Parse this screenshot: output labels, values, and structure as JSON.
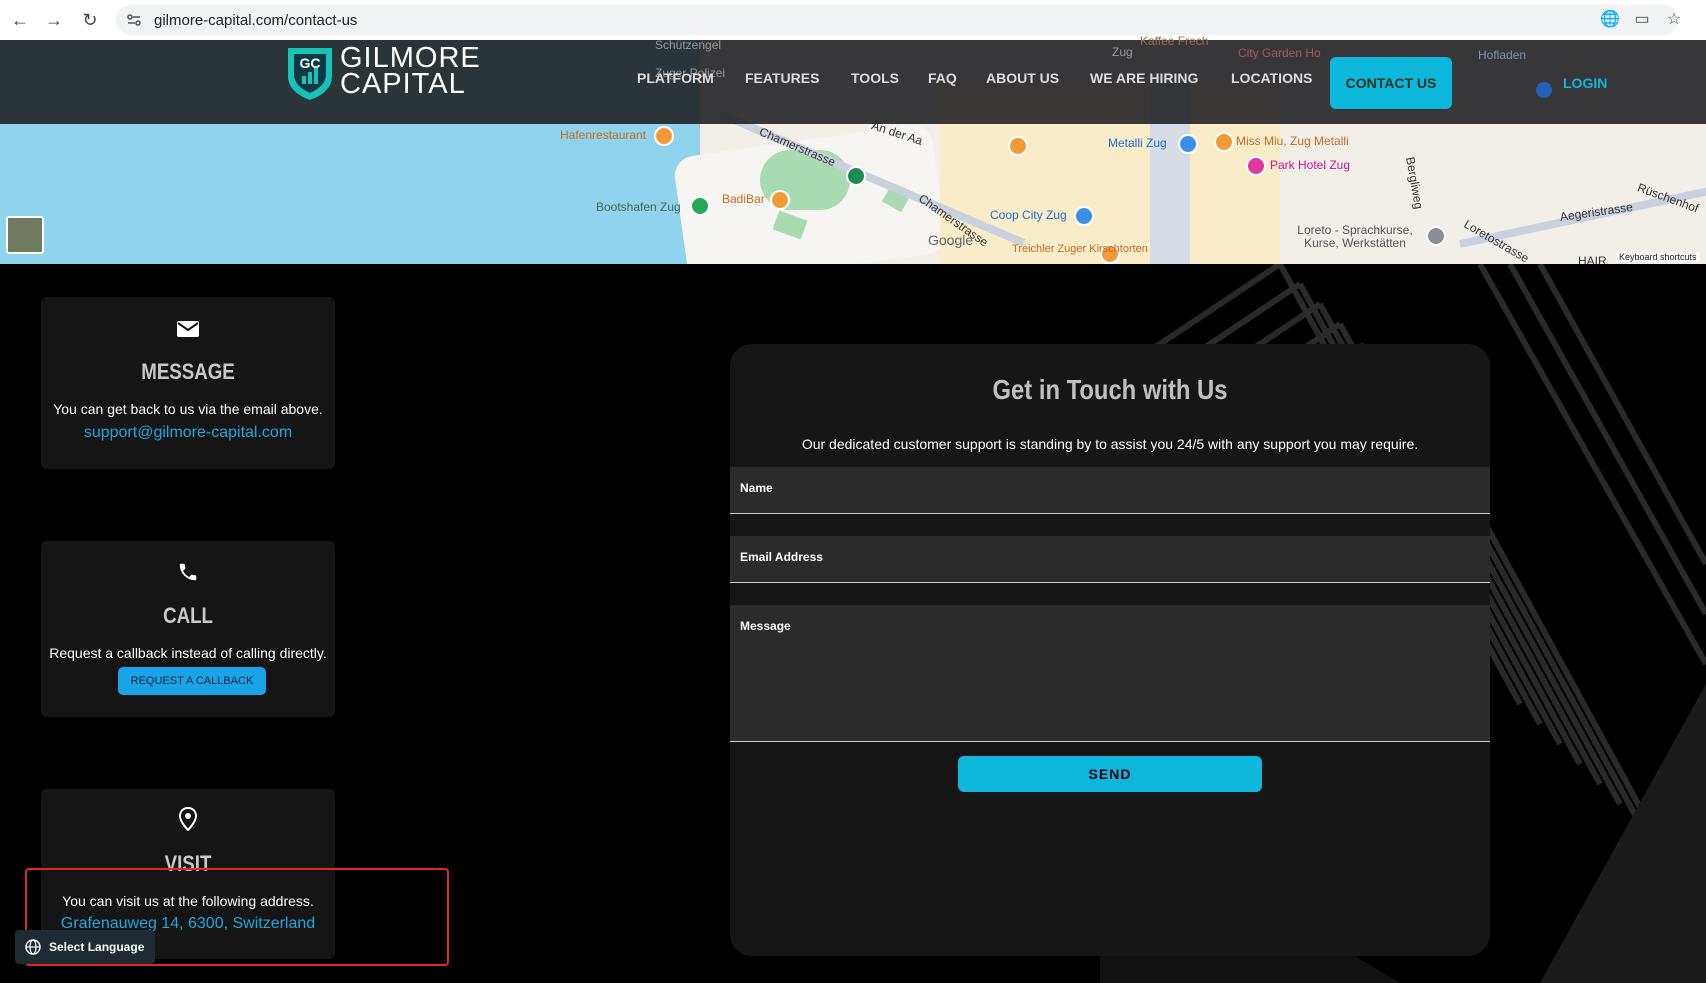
{
  "browser": {
    "url": "gilmore-capital.com/contact-us"
  },
  "map": {
    "labels": {
      "hafenrestaurant": "Hafenrestaurant",
      "bootshafen": "Bootshafen Zug",
      "badibar": "BadiBar",
      "metalli": "Metalli Zug",
      "miss_miu": "Miss Miu, Zug Metalli",
      "park_hotel": "Park Hotel Zug",
      "coop": "Coop City Zug",
      "treichler": "Treichler Zuger Kirschtorten",
      "loreto": "Loreto - Sprachkurse, Kurse, Werkstätten",
      "zuger_polizei": "Zuger Polizei",
      "zug": "Zug",
      "schuetzengel": "Schützengel",
      "hoflade": "Hofladen",
      "city_garden": "City Garden Ho",
      "kaffee": "Kaffee Frech",
      "chamerstrasse": "Chamerstrasse",
      "an_der_aa": "An der Aa",
      "aegeristrasse": "Aegeristrasse",
      "lorestrasse": "Loretostrasse",
      "rueschenhof": "Rüschenhof",
      "bergliweg": "Bergliweg",
      "hair": "HAIR"
    },
    "google": "Google",
    "keyboard": "Keyboard shortcuts"
  },
  "header": {
    "logo_line1": "GILMORE",
    "logo_line2": "CAPITAL",
    "logo_mark": "GC",
    "nav": [
      "PLATFORM",
      "FEATURES",
      "TOOLS",
      "FAQ",
      "ABOUT US",
      "WE ARE HIRING",
      "LOCATIONS"
    ],
    "contact": "CONTACT US",
    "login": "LOGIN"
  },
  "cards": {
    "message": {
      "title": "MESSAGE",
      "desc": "You can get back to us via the email above.",
      "link": "support@gilmore-capital.com"
    },
    "call": {
      "title": "CALL",
      "desc": "Request a callback instead of calling directly.",
      "button": "REQUEST A CALLBACK"
    },
    "visit": {
      "title": "VISIT",
      "desc": "You can visit us at the following address.",
      "link": "Grafenauweg 14, 6300, Switzerland"
    }
  },
  "form": {
    "title": "Get in Touch with Us",
    "subtitle": "Our dedicated customer support is standing by to assist you 24/5 with any support you may require.",
    "name_label": "Name",
    "email_label": "Email Address",
    "message_label": "Message",
    "send": "SEND"
  },
  "language": {
    "label": "Select Language"
  },
  "colors": {
    "accent": "#0db8dc",
    "link": "#1fa9e0",
    "highlight": "#e0282a"
  }
}
